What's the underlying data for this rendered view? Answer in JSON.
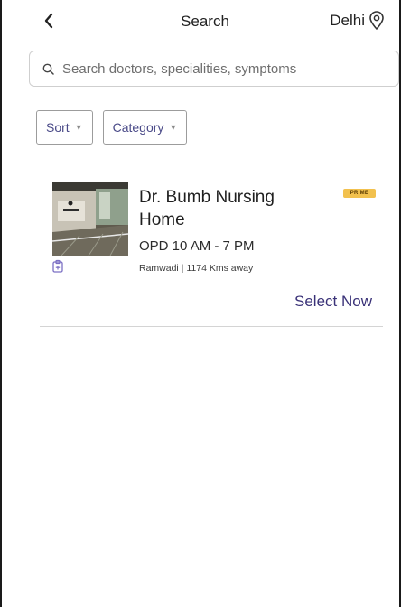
{
  "header": {
    "title": "Search",
    "location": "Delhi",
    "back_icon": "chevron-left-icon",
    "location_icon": "map-pin-icon"
  },
  "search": {
    "placeholder": "Search doctors, specialities, symptoms",
    "value": "",
    "icon": "search-icon"
  },
  "filters": {
    "sort_label": "Sort",
    "category_label": "Category"
  },
  "results": [
    {
      "name": "Dr. Bumb Nursing Home",
      "badge": "PRIME",
      "opd_timing": "OPD 10 AM - 7 PM",
      "address": "Ramwadi | 1174 Kms away",
      "action_label": "Select Now"
    }
  ],
  "colors": {
    "accent": "#3a3278",
    "badge_bg": "#f2c14e",
    "icon_purple": "#7b6fc4"
  }
}
